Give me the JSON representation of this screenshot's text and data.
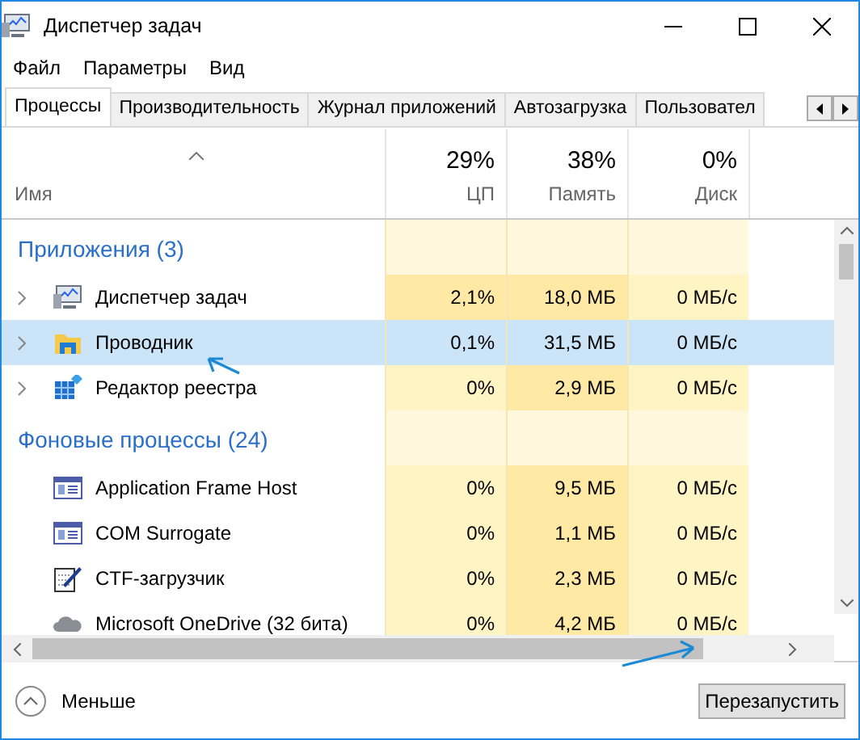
{
  "window": {
    "title": "Диспетчер задач"
  },
  "menu": [
    "Файл",
    "Параметры",
    "Вид"
  ],
  "tabs": [
    {
      "label": "Процессы",
      "selected": true
    },
    {
      "label": "Производительность",
      "selected": false
    },
    {
      "label": "Журнал приложений",
      "selected": false
    },
    {
      "label": "Автозагрузка",
      "selected": false
    },
    {
      "label": "Пользовател",
      "selected": false
    }
  ],
  "columns": [
    {
      "label": "Имя"
    },
    {
      "percent": "29%",
      "label": "ЦП"
    },
    {
      "percent": "38%",
      "label": "Память"
    },
    {
      "percent": "0%",
      "label": "Диск"
    }
  ],
  "groups": [
    {
      "title": "Приложения (3)",
      "rows": [
        {
          "name": "Диспетчер задач",
          "kind": "monitor",
          "expandable": true,
          "selected": false,
          "cells": [
            {
              "text": "2,1%",
              "hot": true
            },
            {
              "text": "18,0 МБ",
              "hot": true
            },
            {
              "text": "0 МБ/с",
              "hot": false
            }
          ]
        },
        {
          "name": "Проводник",
          "kind": "folder",
          "expandable": true,
          "selected": true,
          "cells": [
            {
              "text": "0,1%"
            },
            {
              "text": "31,5 МБ"
            },
            {
              "text": "0 МБ/с"
            }
          ]
        },
        {
          "name": "Редактор реестра",
          "kind": "grid",
          "expandable": true,
          "selected": false,
          "cells": [
            {
              "text": "0%",
              "hot": false
            },
            {
              "text": "2,9 МБ",
              "hot": true
            },
            {
              "text": "0 МБ/с",
              "hot": false
            }
          ]
        }
      ]
    },
    {
      "title": "Фоновые процессы (24)",
      "rows": [
        {
          "name": "Application Frame Host",
          "kind": "window",
          "expandable": false,
          "selected": false,
          "cells": [
            {
              "text": "0%",
              "hot": false
            },
            {
              "text": "9,5 МБ",
              "hot": true
            },
            {
              "text": "0 МБ/с",
              "hot": false
            }
          ]
        },
        {
          "name": "COM Surrogate",
          "kind": "window",
          "expandable": false,
          "selected": false,
          "cells": [
            {
              "text": "0%",
              "hot": false
            },
            {
              "text": "1,1 МБ",
              "hot": true
            },
            {
              "text": "0 МБ/с",
              "hot": false
            }
          ]
        },
        {
          "name": "CTF-загрузчик",
          "kind": "pen",
          "expandable": false,
          "selected": false,
          "cells": [
            {
              "text": "0%",
              "hot": false
            },
            {
              "text": "2,3 МБ",
              "hot": true
            },
            {
              "text": "0 МБ/с",
              "hot": false
            }
          ]
        },
        {
          "name": "Microsoft OneDrive (32 бита)",
          "kind": "cloud",
          "expandable": false,
          "selected": false,
          "cells": [
            {
              "text": "0%",
              "hot": false
            },
            {
              "text": "4,2 МБ",
              "hot": true
            },
            {
              "text": "0 МБ/с",
              "hot": false
            }
          ]
        }
      ]
    }
  ],
  "footer": {
    "less": "Меньше",
    "button": "Перезапустить"
  }
}
